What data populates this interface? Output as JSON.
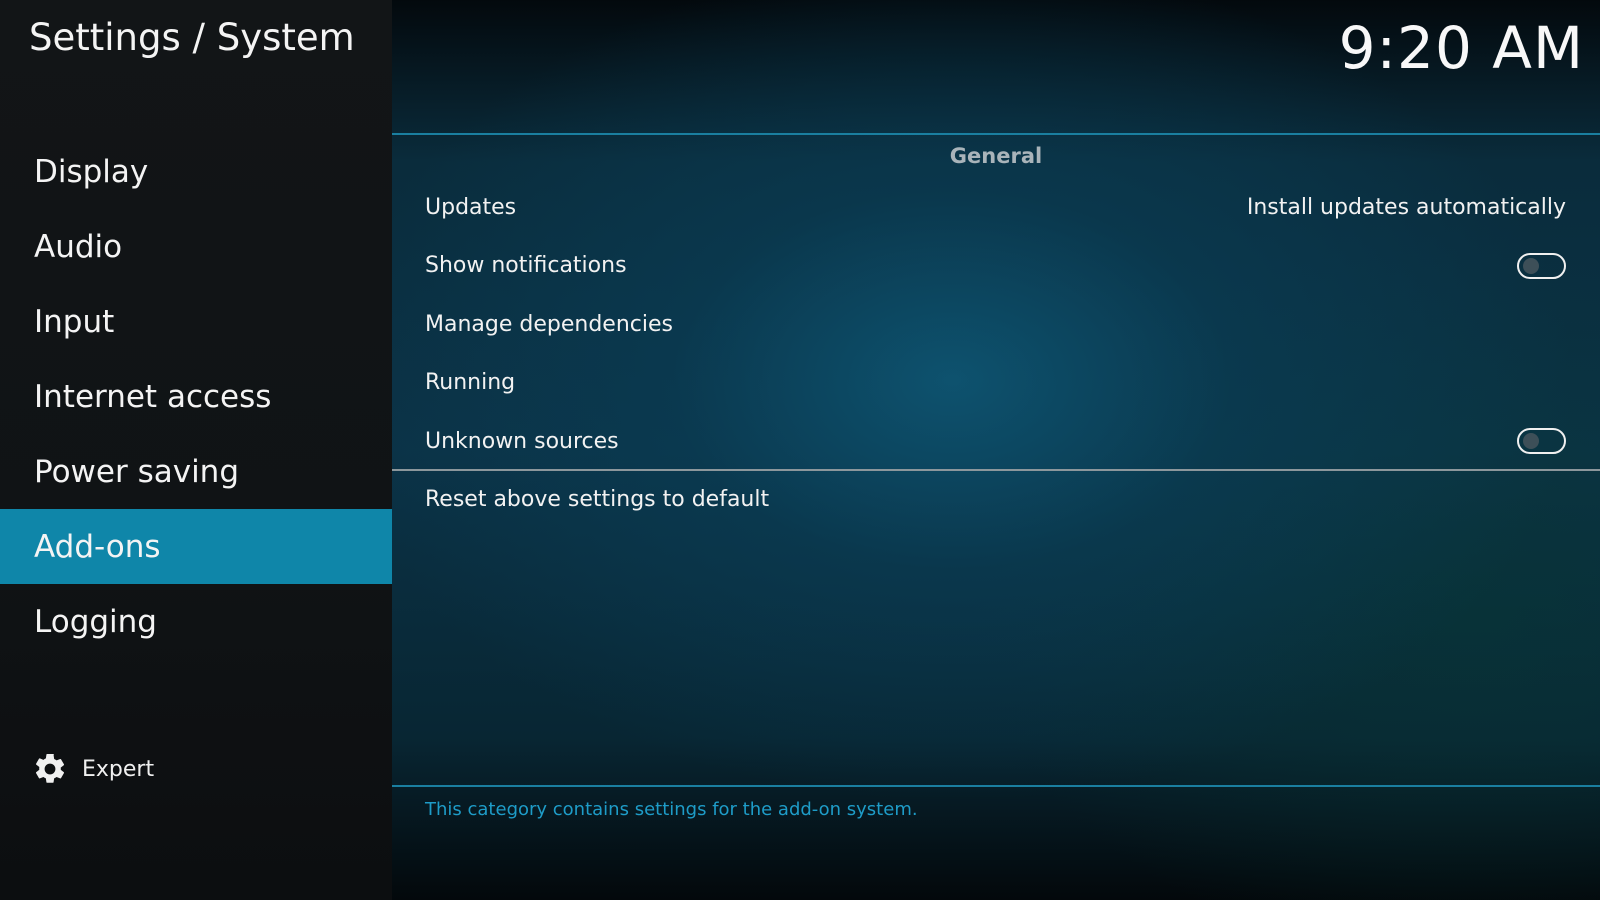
{
  "header": {
    "title": "Settings / System",
    "clock": "9:20 AM"
  },
  "sidebar": {
    "items": [
      {
        "label": "Display"
      },
      {
        "label": "Audio"
      },
      {
        "label": "Input"
      },
      {
        "label": "Internet access"
      },
      {
        "label": "Power saving"
      },
      {
        "label": "Add-ons",
        "selected": true
      },
      {
        "label": "Logging"
      }
    ],
    "settings_level": {
      "label": "Expert",
      "icon": "gear-icon"
    }
  },
  "main": {
    "section_header": "General",
    "settings": [
      {
        "label": "Updates",
        "value": "Install updates automatically"
      },
      {
        "label": "Show notifications",
        "toggle": false
      },
      {
        "label": "Manage dependencies"
      },
      {
        "label": "Running"
      },
      {
        "label": "Unknown sources",
        "toggle": false
      }
    ],
    "reset_label": "Reset above settings to default",
    "help_text": "This category contains settings for the add-on system."
  },
  "colors": {
    "accent": "#0f86a9",
    "help_text": "#1e9cc8",
    "sidebar_bg": "#121517"
  }
}
